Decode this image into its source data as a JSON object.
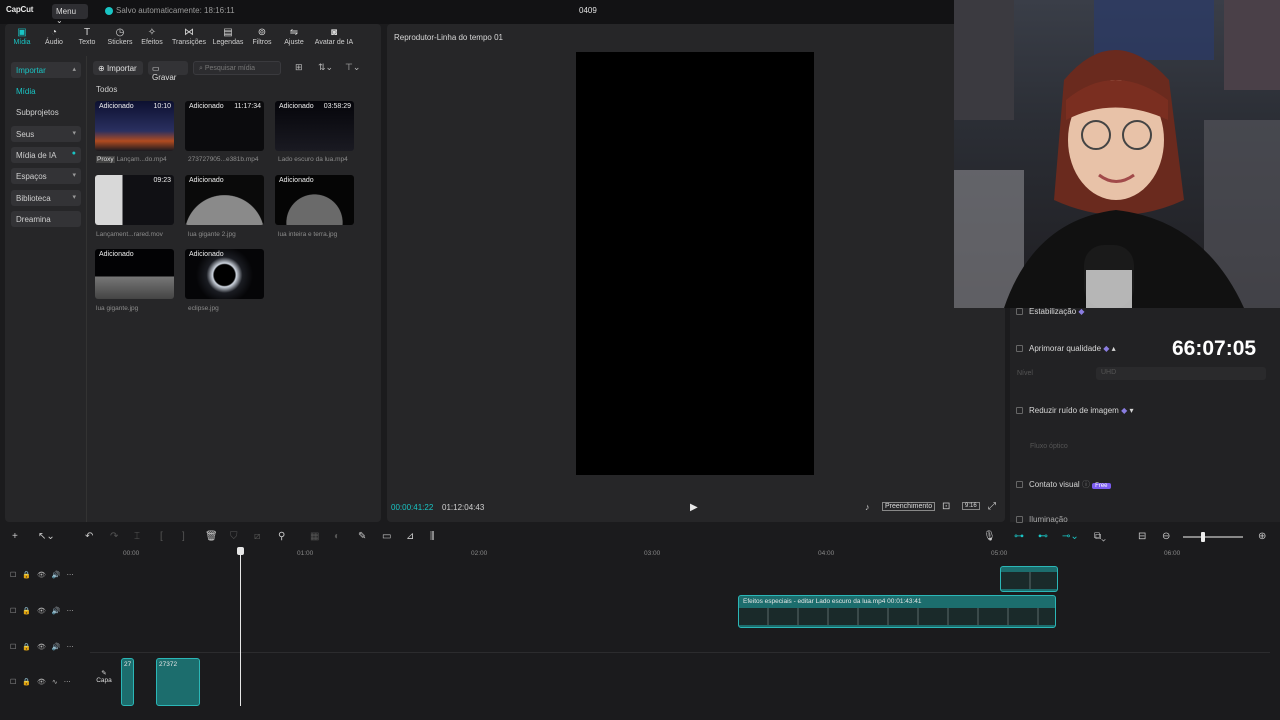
{
  "titlebar": {
    "logo": "CapCut",
    "menu_label": "Menu ⌄",
    "save_status": "Salvo automaticamente: 18:16:11",
    "project_name": "0409"
  },
  "toolbar": {
    "tools": [
      "Mídia",
      "Áudio",
      "Texto",
      "Stickers",
      "Efeitos",
      "Transições",
      "Legendas",
      "Filtros",
      "Ajuste",
      "Avatar de IA"
    ]
  },
  "sidebar": {
    "items": [
      "Importar",
      "Mídia",
      "Subprojetos",
      "Seus",
      "Mídia de IA",
      "Espaços",
      "Biblioteca",
      "Dreamina"
    ]
  },
  "media": {
    "import_label": "Importar",
    "record_label": "Gravar",
    "search_placeholder": "Pesquisar mídia",
    "all_label": "Todos",
    "items": [
      {
        "tag": "Adicionado",
        "duration": "10:10",
        "name": "Lançam...do.mp4",
        "proxy": "Proxy"
      },
      {
        "tag": "Adicionado",
        "duration": "11:17:34",
        "name": "273727905...e381b.mp4"
      },
      {
        "tag": "Adicionado",
        "duration": "03:58:29",
        "name": "Lado escuro da lua.mp4"
      },
      {
        "tag": "",
        "duration": "09:23",
        "name": "Lançament...rared.mov"
      },
      {
        "tag": "Adicionado",
        "duration": "",
        "name": "lua gigante 2.jpg"
      },
      {
        "tag": "Adicionado",
        "duration": "",
        "name": "lua inteira e terra.jpg"
      },
      {
        "tag": "Adicionado",
        "duration": "",
        "name": "lua gigante.jpg"
      },
      {
        "tag": "Adicionado",
        "duration": "",
        "name": "eclipse.jpg"
      }
    ]
  },
  "player": {
    "title": "Reprodutor-Linha do tempo 01",
    "current_time": "00:00:41:22",
    "total_time": "01:12:04:43",
    "fill_label": "Preenchimento",
    "ratio_label": "9:16"
  },
  "inspector": {
    "stabilize": "Estabilização",
    "enhance": "Aprimorar qualidade",
    "level_label": "Nível",
    "level_value": "UHD",
    "denoise": "Reduzir ruído de imagem",
    "optical_flow": "Fluxo óptico",
    "visual_contact": "Contato visual",
    "free_badge": "Free",
    "lighting": "Iluminação"
  },
  "overlay": {
    "timer": "66:07:05"
  },
  "timeline": {
    "ticks": [
      "00:00",
      "01:00",
      "02:00",
      "03:00",
      "04:00",
      "05:00",
      "06:00"
    ],
    "clip_main_label": "Efeitos especiais - editar  Lado escuro da lua.mp4  00:01:43:41",
    "small_clip_a": "27",
    "small_clip_b": "27372",
    "cover_label": "Capa"
  },
  "colors": {
    "accent": "#19c4c4",
    "clip": "#1c6d6d",
    "bg": "#1b1b1d"
  }
}
